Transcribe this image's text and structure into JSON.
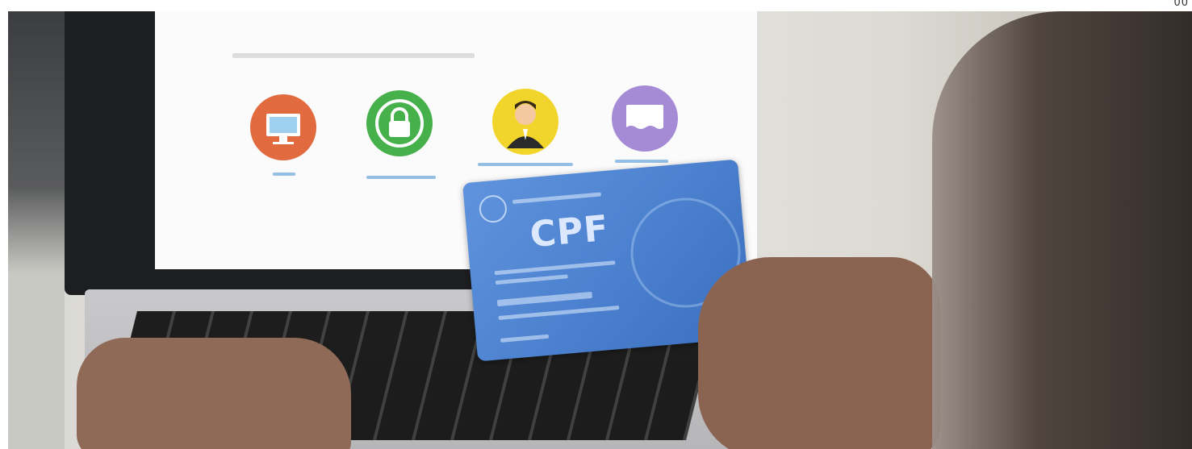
{
  "corner_text": "00",
  "card": {
    "title": "CPF"
  },
  "colors": {
    "orange_icon": "#e16b3f",
    "green_icon": "#46b04a",
    "yellow_icon": "#f2d52a",
    "purple_icon": "#a58bd6",
    "card_blue": "#4d82d0"
  }
}
